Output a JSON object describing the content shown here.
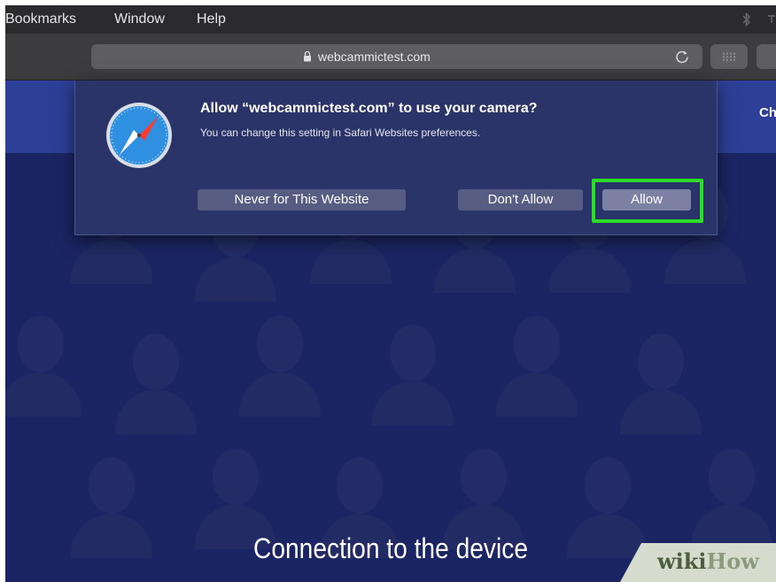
{
  "menubar": {
    "items": [
      "Bookmarks",
      "Window",
      "Help"
    ]
  },
  "toolbar": {
    "url": "webcammictest.com"
  },
  "site": {
    "header_text": "Ch",
    "title": "Connection to the device"
  },
  "dialog": {
    "title": "Allow “webcammictest.com” to use your camera?",
    "subtitle": "You can change this setting in Safari Websites preferences.",
    "buttons": {
      "never": "Never for This Website",
      "dont_allow": "Don't Allow",
      "allow": "Allow"
    },
    "icon": "safari-icon"
  },
  "watermark": {
    "wiki": "wiki",
    "how": "How"
  },
  "colors": {
    "highlight": "#29e027",
    "site_background": "#1b2563",
    "site_header": "#2d3f96",
    "dialog": "#2b3468"
  }
}
